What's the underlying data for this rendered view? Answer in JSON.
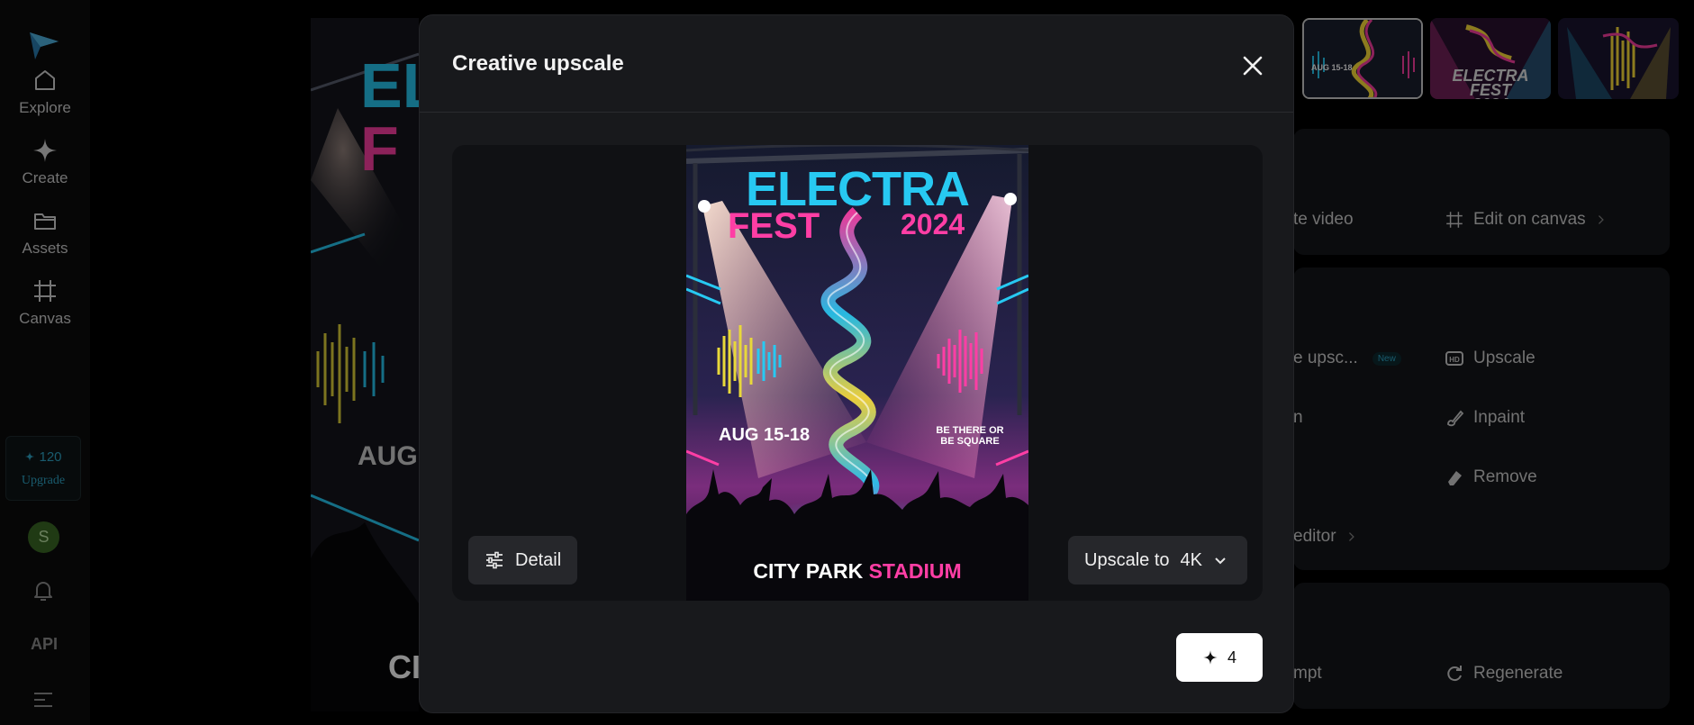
{
  "sidebar": {
    "items": [
      {
        "label": "Explore",
        "icon": "home-icon"
      },
      {
        "label": "Create",
        "icon": "sparkle-icon"
      },
      {
        "label": "Assets",
        "icon": "folder-icon"
      },
      {
        "label": "Canvas",
        "icon": "canvas-frame-icon"
      }
    ],
    "credits": "120",
    "upgrade_label": "Upgrade",
    "avatar_initial": "S",
    "api_label": "API"
  },
  "background": {
    "poster_peek": {
      "title_fragment_1": "EL",
      "title_fragment_2": "F",
      "date_fragment": "AUG",
      "venue_fragment": "CI"
    },
    "thumbnails": [
      {
        "caption": "AUG 15-18",
        "selected": true
      },
      {
        "caption": "ELECTRA FEST 2024",
        "selected": false
      },
      {
        "caption": "",
        "selected": false
      }
    ],
    "actions": {
      "create_video": "te video",
      "edit_on_canvas": "Edit on canvas",
      "creative_upscale": "e upsc...",
      "new_badge": "New",
      "upscale": "Upscale",
      "generic_2": "n",
      "inpaint": "Inpaint",
      "remove": "Remove",
      "editor": "editor",
      "prompt": "mpt",
      "regenerate": "Regenerate"
    }
  },
  "modal": {
    "title": "Creative upscale",
    "detail_label": "Detail",
    "upscale_label": "Upscale to",
    "upscale_value": "4K",
    "generate_cost": "4",
    "poster": {
      "title_line1": "ELECTRA",
      "title_line2_a": "FEST",
      "title_line2_b": "2024",
      "dates": "AUG 15-18",
      "tagline_1": "BE THERE OR",
      "tagline_2": "BE SQUARE",
      "venue_a": "CITY PARK",
      "venue_b": "STADIUM"
    }
  },
  "colors": {
    "accent": "#2fa7c8",
    "pink": "#ff3ea5",
    "cyan": "#27c9f2",
    "yellow": "#ffe03a"
  }
}
